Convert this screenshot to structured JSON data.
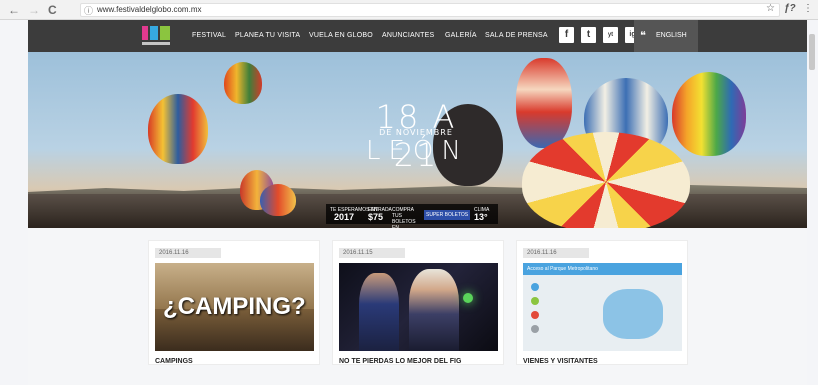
{
  "browser": {
    "url": "www.festivaldelglobo.com.mx",
    "back": "←",
    "forward": "→",
    "reload": "C",
    "star": "☆",
    "ext": "ƒ?",
    "menu": "⋮"
  },
  "nav": {
    "items": [
      "FESTIVAL",
      "PLANEA TU VISITA",
      "VUELA EN GLOBO",
      "ANUNCIANTES",
      "GALERÍA",
      "SALA DE PRENSA"
    ],
    "language": "ENGLISH",
    "social": [
      "f",
      "t",
      "yt",
      "ig"
    ]
  },
  "hero": {
    "dates": "18 A 21",
    "month": "DE NOVIEMBRE",
    "city": "LEÓN",
    "info": {
      "year_label": "TE ESPERAMOS EN",
      "year": "2017",
      "price_label": "ENTRADA",
      "price": "$75",
      "tickets_label": "COMPRA TUS BOLETOS EN",
      "partner": "SUPER BOLETOS",
      "climate_label": "CLIMA",
      "temp": "13°"
    }
  },
  "cards": [
    {
      "date": "2016.11.16",
      "image_text": "¿CAMPING?",
      "title": "CAMPINGS"
    },
    {
      "date": "2016.11.15",
      "title": "NO TE PIERDAS LO MEJOR DEL FIG"
    },
    {
      "date": "2016.11.16",
      "map_title": "Acceso al Parque Metropolitano",
      "title": "VIENES Y VISITANTES"
    }
  ],
  "colors": {
    "nav_bg": "#3c3c3c",
    "content_bg": "#f5f6f8",
    "english_bg": "#555555"
  }
}
